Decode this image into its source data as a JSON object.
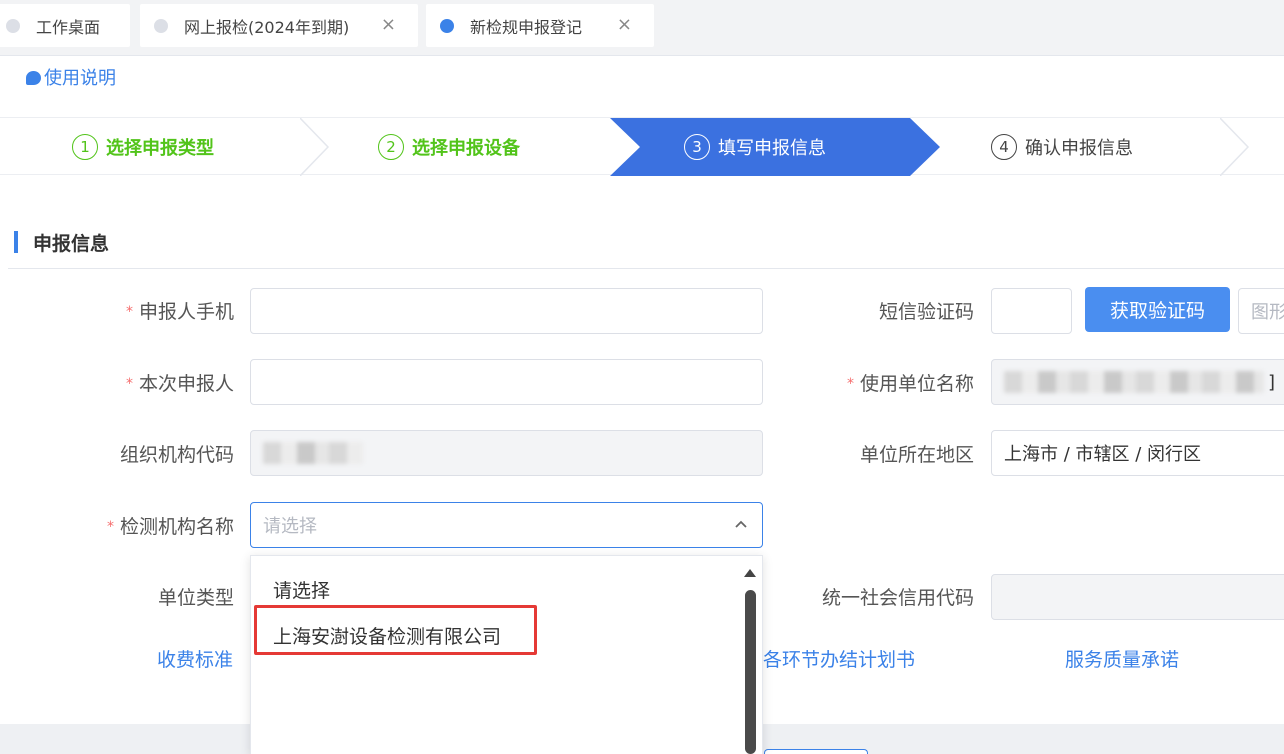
{
  "tabs": [
    {
      "label": "工作桌面",
      "active": false,
      "closable": false
    },
    {
      "label": "网上报检(2024年到期)",
      "active": false,
      "closable": true
    },
    {
      "label": "新检规申报登记",
      "active": true,
      "closable": true
    }
  ],
  "tab_close_glyph": "×",
  "help_link": "使用说明",
  "steps": [
    {
      "num": "1",
      "label": "选择申报类型",
      "state": "done"
    },
    {
      "num": "2",
      "label": "选择申报设备",
      "state": "done"
    },
    {
      "num": "3",
      "label": "填写申报信息",
      "state": "active"
    },
    {
      "num": "4",
      "label": "确认申报信息",
      "state": "todo"
    }
  ],
  "section_title": "申报信息",
  "form": {
    "applicant_phone": {
      "label": "申报人手机",
      "required": true,
      "value": ""
    },
    "applicant": {
      "label": "本次申报人",
      "required": true,
      "value": ""
    },
    "org_code": {
      "label": "组织机构代码",
      "required": false,
      "value": ""
    },
    "inspection_org": {
      "label": "检测机构名称",
      "required": true,
      "placeholder": "请选择"
    },
    "unit_type": {
      "label": "单位类型",
      "required": false
    },
    "sms_code": {
      "label": "短信验证码",
      "required": false,
      "value": "",
      "button": "获取验证码",
      "captcha_placeholder": "图形"
    },
    "unit_name": {
      "label": "使用单位名称",
      "required": true,
      "value_suffix": "]"
    },
    "unit_region": {
      "label": "单位所在地区",
      "required": false,
      "value": "上海市 / 市辖区 / 闵行区"
    },
    "credit_code": {
      "label": "统一社会信用代码",
      "required": false,
      "value": ""
    }
  },
  "required_mark": "*",
  "dropdown_options": [
    "请选择",
    "上海安澍设备检测有限公司"
  ],
  "links": {
    "fee_standard": "收费标准",
    "plan": "各环节办结计划书",
    "service_commitment": "服务质量承诺"
  },
  "colors": {
    "accent": "#3b82e8",
    "step_done": "#52c41a",
    "step_active_bg": "#3b71e0",
    "required": "#f56c6c",
    "highlight_box": "#e53935"
  }
}
